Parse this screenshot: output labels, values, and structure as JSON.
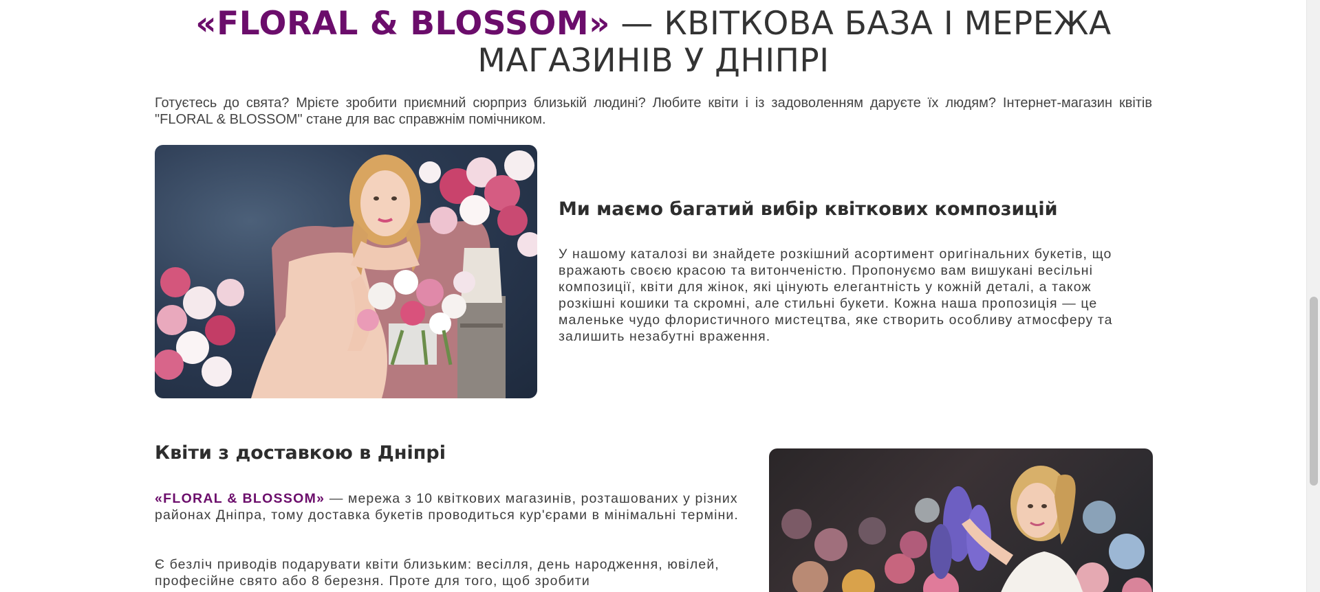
{
  "hero": {
    "brand": "«FLORAL & BLOSSOM»",
    "title_rest": " — КВІТКОВА БАЗА І МЕРЕЖА МАГАЗИНІВ У ДНІПРІ"
  },
  "intro": "Готуєтесь до свята? Мрієте зробити приємний сюрприз близькій людині? Любите квіти і із задоволенням даруєте їх людям? Інтернет-магазин квітів \"FLORAL & BLOSSOM\" стане для вас справжнім помічником.",
  "section1": {
    "title": "Ми маємо багатий вибір квіткових композицій",
    "text": "У нашому каталозі ви знайдете розкішний асортимент оригінальних букетів, що вражають своєю красою та витонченістю. Пропонуємо вам вишукані весільні композиції, квіти для жінок, які цінують елегантність у кожній деталі, а також розкішні кошики та скромні, але стильні букети. Кожна наша пропозиція — це маленьке чудо флористичного мистецтва, яке створить особливу атмосферу та залишить незабутні враження."
  },
  "section2": {
    "title": "Квіти з доставкою в Дніпрі",
    "brand": "«FLORAL & BLOSSOM»",
    "text1_rest": " — мережа з 10 квіткових магазинів, розташованих у різних районах Дніпра, тому доставка букетів проводиться кур'єрами в мінімальні терміни.",
    "text2": "Є безліч приводів подарувати квіти близьким: весілля, день народження, ювілей, професійне свято або 8 березня. Проте для того, щоб зробити"
  },
  "colors": {
    "brand": "#6b0d6b",
    "text": "#333333"
  }
}
